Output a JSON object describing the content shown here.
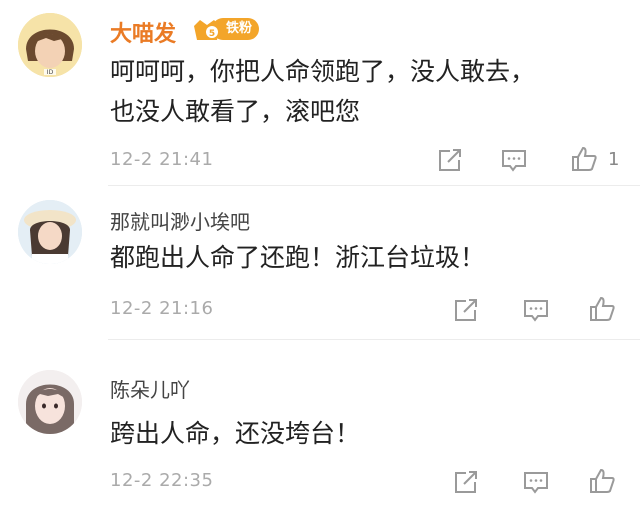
{
  "comments": [
    {
      "username": "大喵发",
      "badge": "铁粉",
      "badge_level": "5",
      "text_line1": "呵呵呵，你把人命领跑了，没人敢去，",
      "text_line2": "也没人敢看了，滚吧您",
      "time": "12-2 21:41",
      "likes": "1",
      "avatar_caption": "ID"
    },
    {
      "username": "那就叫渺小埃吧",
      "text": "都跑出人命了还跑！浙江台垃圾！",
      "time": "12-2 21:16"
    },
    {
      "username": "陈朵儿吖",
      "text": "跨出人命，还没垮台！",
      "time": "12-2 22:35"
    }
  ],
  "icons": {
    "share": "share-icon",
    "comment": "comment-icon",
    "like": "thumb-up-icon"
  },
  "colors": {
    "highlight_name": "#ea7b25",
    "badge": "#f3a52a",
    "meta": "#aaaaaa",
    "icon": "#9a9a9a"
  }
}
